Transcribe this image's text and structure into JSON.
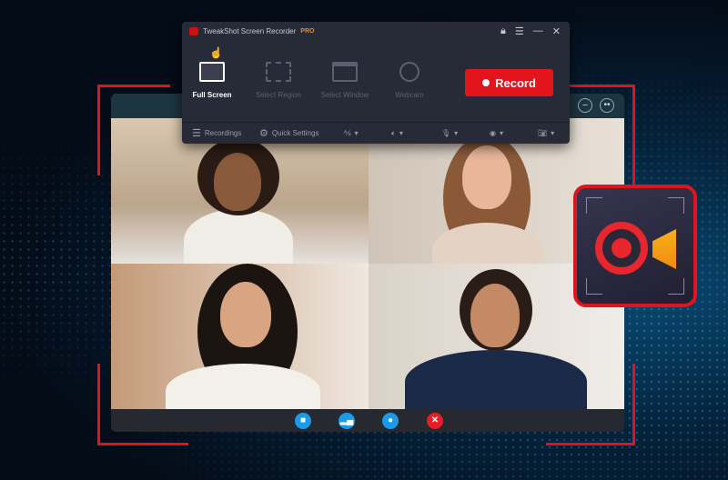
{
  "app": {
    "title": "TweakShot Screen Recorder",
    "badge": "PRO"
  },
  "window_controls": [
    "lock-icon",
    "menu-icon",
    "minimize-icon",
    "close-icon"
  ],
  "modes": [
    {
      "label": "Full Screen",
      "active": true
    },
    {
      "label": "Select Region",
      "active": false
    },
    {
      "label": "Select Window",
      "active": false
    },
    {
      "label": "Webcam",
      "active": false
    }
  ],
  "record_button": {
    "label": "Record",
    "color": "#e2151d"
  },
  "toolbar": {
    "recordings": "Recordings",
    "quick_settings": "Quick Settings",
    "icons": [
      "cursor-off-icon",
      "speaker-icon",
      "microphone-icon",
      "webcam-icon",
      "camera-icon"
    ]
  },
  "call": {
    "controls": [
      "video-icon",
      "signal-icon",
      "chat-icon",
      "end-call-icon"
    ]
  },
  "colors": {
    "accent": "#e0141e",
    "pro": "#f08a1c",
    "call_button": "#1a9be8"
  }
}
